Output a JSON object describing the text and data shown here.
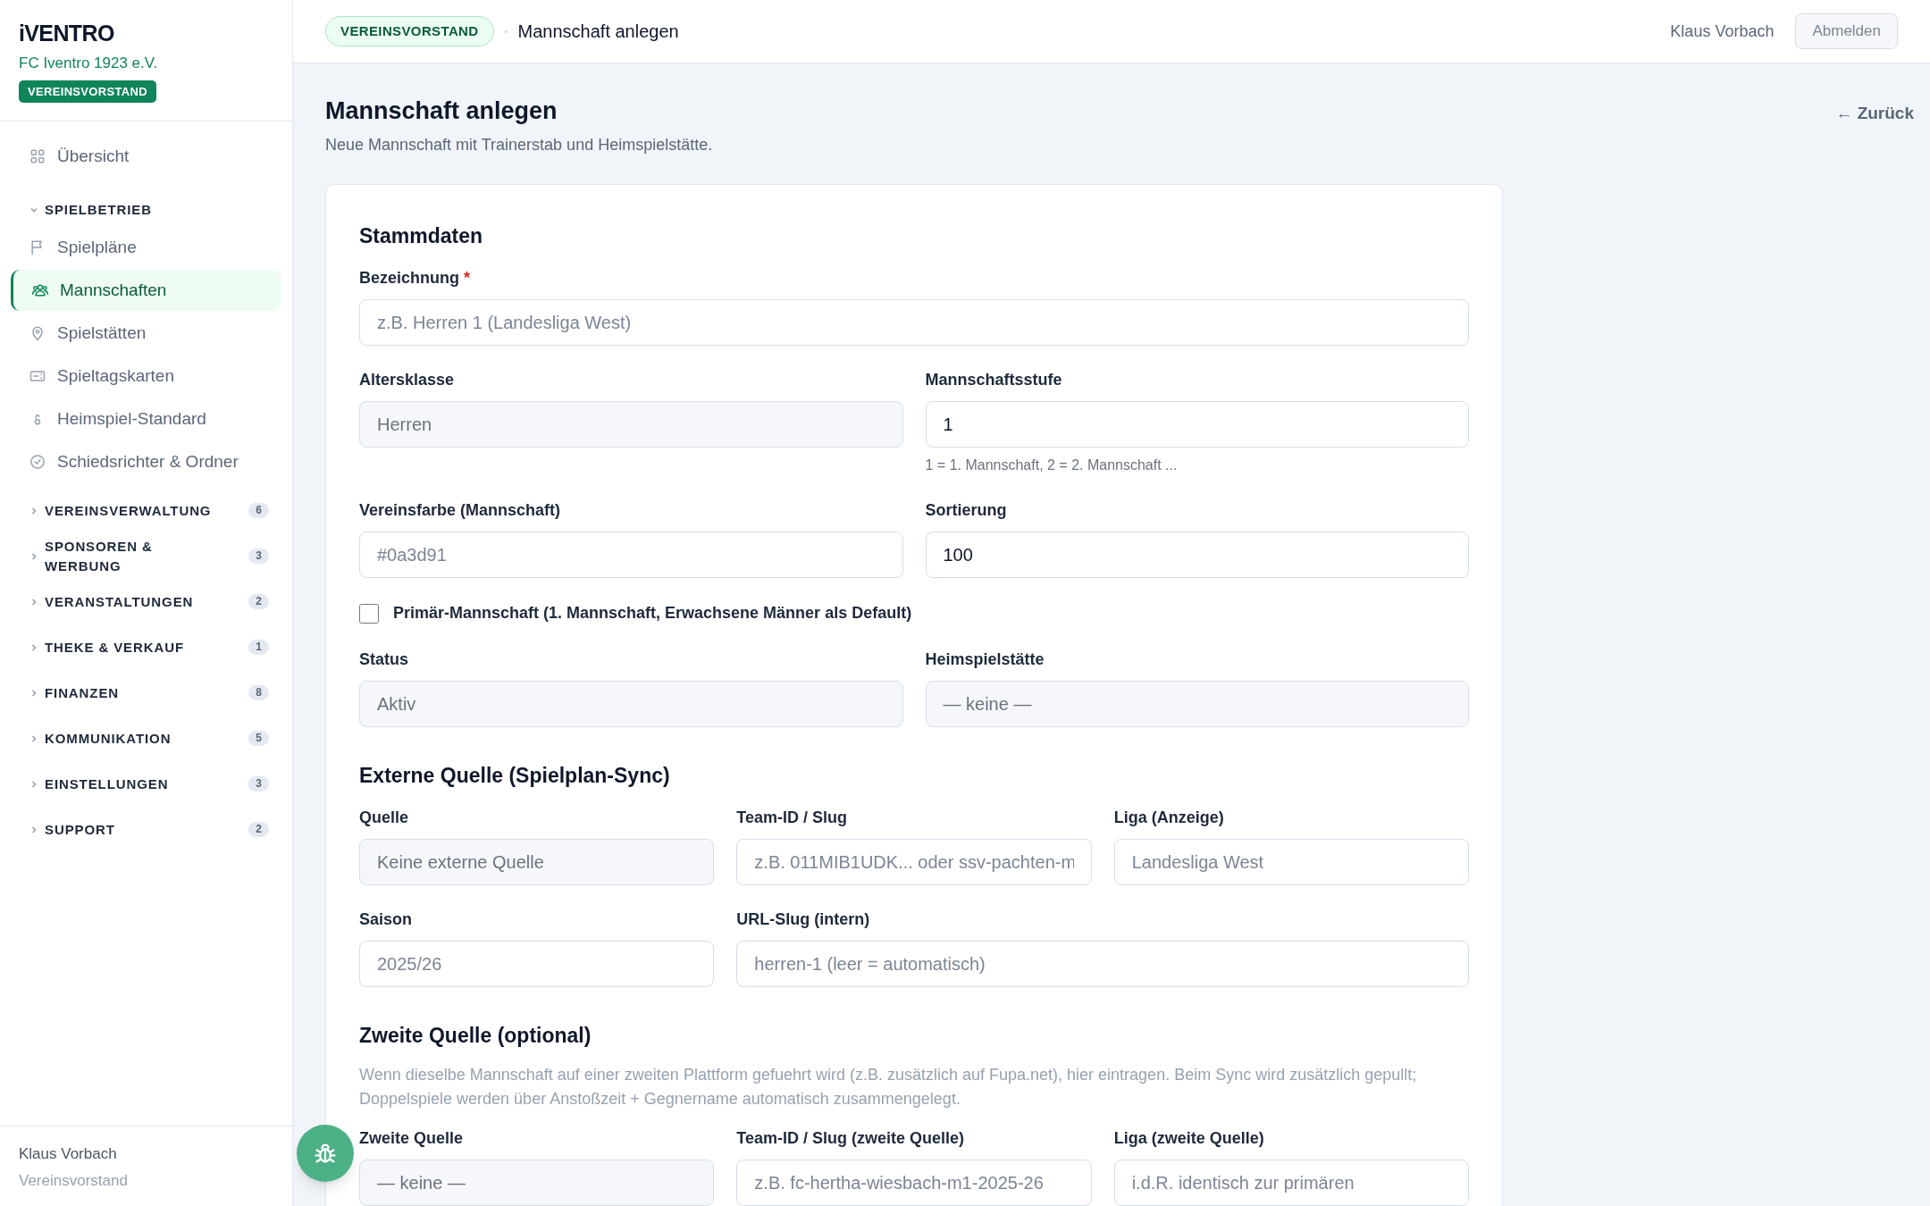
{
  "sidebar": {
    "logo": "iVENTRO",
    "club": "FC Iventro 1923 e.V.",
    "role_badge": "VEREINSVORSTAND",
    "top_items": [
      {
        "label": "Übersicht",
        "selected": false
      }
    ],
    "sections": [
      {
        "title": "SPIELBETRIEB",
        "expanded": true,
        "children": [
          {
            "label": "Spielpläne",
            "selected": false
          },
          {
            "label": "Mannschaften",
            "selected": true
          },
          {
            "label": "Spielstätten",
            "selected": false
          },
          {
            "label": "Spieltagskarten",
            "selected": false
          },
          {
            "label": "Heimspiel-Standard",
            "selected": false
          },
          {
            "label": "Schiedsrichter & Ordner",
            "selected": false
          }
        ]
      },
      {
        "title": "VEREINSVERWALTUNG",
        "expanded": false,
        "count": "6"
      },
      {
        "title": "SPONSOREN & WERBUNG",
        "expanded": false,
        "count": "3"
      },
      {
        "title": "VERANSTALTUNGEN",
        "expanded": false,
        "count": "2"
      },
      {
        "title": "THEKE & VERKAUF",
        "expanded": false,
        "count": "1"
      },
      {
        "title": "FINANZEN",
        "expanded": false,
        "count": "8"
      },
      {
        "title": "KOMMUNIKATION",
        "expanded": false,
        "count": "5"
      },
      {
        "title": "EINSTELLUNGEN",
        "expanded": false,
        "count": "3"
      },
      {
        "title": "SUPPORT",
        "expanded": false,
        "count": "2"
      }
    ],
    "user": {
      "name": "Klaus Vorbach",
      "role": "Vereinsvorstand"
    }
  },
  "header": {
    "badge": "VEREINSVORSTAND",
    "breadcrumb": "Mannschaft anlegen",
    "user": "Klaus Vorbach",
    "logout": "Abmelden"
  },
  "page": {
    "title": "Mannschaft anlegen",
    "subtitle": "Neue Mannschaft mit Trainerstab und Heimspielstätte.",
    "back": "← Zurück"
  },
  "form": {
    "sections": [
      {
        "title": "Stammdaten",
        "rows": [
          {
            "fields": [
              {
                "kind": "input",
                "label": "Bezeichnung",
                "required_mark": "*",
                "placeholder": "z.B. Herren 1 (Landesliga West)"
              }
            ]
          },
          {
            "fields": [
              {
                "kind": "select",
                "label": "Altersklasse",
                "value": "Herren"
              },
              {
                "kind": "input",
                "label": "Mannschaftsstufe",
                "value": "1",
                "hint": "1 = 1. Mannschaft, 2 = 2. Mannschaft ..."
              }
            ]
          },
          {
            "fields": [
              {
                "kind": "input",
                "label": "Vereinsfarbe (Mannschaft)",
                "placeholder": "#0a3d91"
              },
              {
                "kind": "input",
                "label": "Sortierung",
                "value": "100"
              }
            ]
          },
          {
            "fields": [
              {
                "kind": "checkbox",
                "label": "Primär-Mannschaft (1. Mannschaft, Erwachsene Männer als Default)",
                "checked": false
              }
            ]
          },
          {
            "fields": [
              {
                "kind": "select",
                "label": "Status",
                "value": "Aktiv"
              },
              {
                "kind": "select",
                "label": "Heimspielstätte",
                "value": "— keine —"
              }
            ]
          }
        ]
      },
      {
        "title": "Externe Quelle (Spielplan-Sync)",
        "rows": [
          {
            "fields": [
              {
                "kind": "select",
                "label": "Quelle",
                "value": "Keine externe Quelle"
              },
              {
                "kind": "input",
                "label": "Team-ID / Slug",
                "placeholder": "z.B. 011MIB1UDK... oder ssv-pachten-m"
              },
              {
                "kind": "input",
                "label": "Liga (Anzeige)",
                "placeholder": "Landesliga West"
              }
            ]
          },
          {
            "fields": [
              {
                "kind": "input",
                "label": "Saison",
                "placeholder": "2025/26"
              },
              {
                "kind": "input",
                "label": "URL-Slug (intern)",
                "placeholder": "herren-1 (leer = automatisch)",
                "wide": true
              }
            ]
          }
        ]
      },
      {
        "title": "Zweite Quelle (optional)",
        "description": "Wenn dieselbe Mannschaft auf einer zweiten Plattform gefuehrt wird (z.B. zusätzlich auf Fupa.net), hier eintragen. Beim Sync wird zusätzlich gepullt; Doppelspiele werden über Anstoßzeit + Gegnername automatisch zusammengelegt.",
        "rows": [
          {
            "fields": [
              {
                "kind": "select",
                "label": "Zweite Quelle",
                "value": "— keine —"
              },
              {
                "kind": "input",
                "label": "Team-ID / Slug (zweite Quelle)",
                "placeholder": "z.B. fc-hertha-wiesbach-m1-2025-26"
              },
              {
                "kind": "input",
                "label": "Liga (zweite Quelle)",
                "placeholder": "i.d.R. identisch zur primären"
              }
            ]
          }
        ]
      }
    ]
  }
}
